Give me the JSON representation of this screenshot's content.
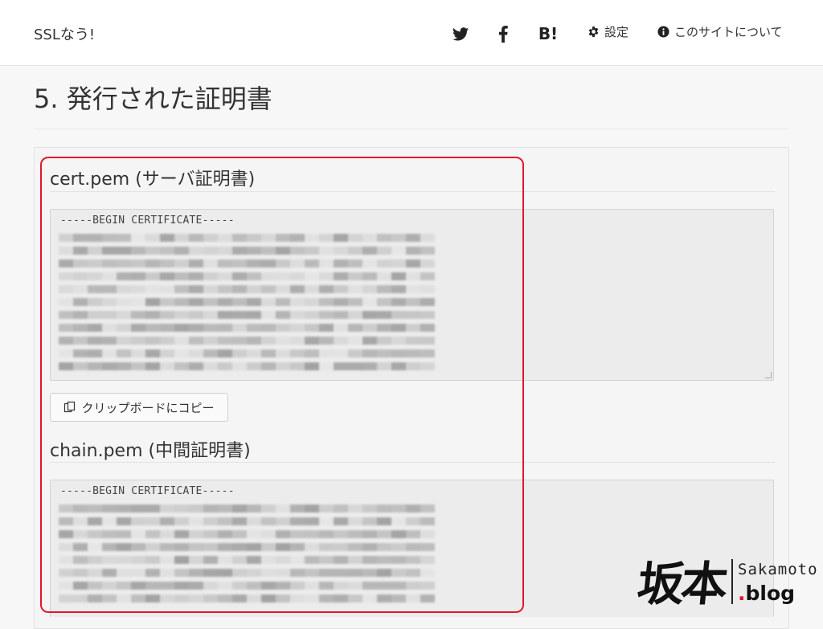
{
  "header": {
    "brand": "SSLなう!",
    "icons": {
      "twitter": "twitter-icon",
      "facebook": "facebook-icon",
      "hatena": "B!"
    },
    "settings_label": "設定",
    "about_label": "このサイトについて"
  },
  "page": {
    "title": "5. 発行された証明書"
  },
  "cert": {
    "title": "cert.pem (サーバ証明書)",
    "pem_header": "-----BEGIN CERTIFICATE-----",
    "copy_label": "クリップボードにコピー"
  },
  "chain": {
    "title": "chain.pem (中間証明書)",
    "pem_header": "-----BEGIN CERTIFICATE-----"
  },
  "watermark": {
    "kanji": "坂本",
    "name": "Sakamoto",
    "dot": ".",
    "blog": "blog"
  },
  "colors": {
    "highlight": "#e0182d",
    "panel": "#f5f5f5",
    "code_bg": "#ececec"
  }
}
